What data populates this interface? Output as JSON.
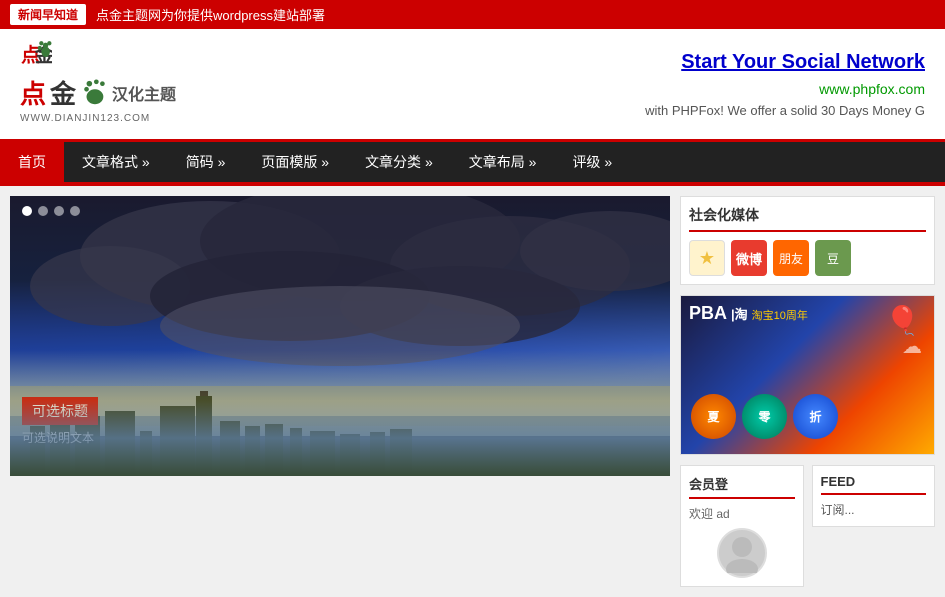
{
  "topbar": {
    "badge": "新闻早知道",
    "message": "点金主题网为你提供wordpress建站部署"
  },
  "header": {
    "logo_chinese": "点金",
    "logo_hanhua": "汉化主题",
    "logo_url": "WWW.DIANJIN123.COM",
    "social_network_title": "Start Your Social Network",
    "phpfox_url": "www.phpfox.com",
    "phpfox_desc": "with PHPFox! We offer a solid 30 Days Money G"
  },
  "nav": {
    "items": [
      {
        "label": "首页",
        "active": true
      },
      {
        "label": "文章格式 »",
        "active": false
      },
      {
        "label": "简码 »",
        "active": false
      },
      {
        "label": "页面模版 »",
        "active": false
      },
      {
        "label": "文章分类 »",
        "active": false
      },
      {
        "label": "文章布局 »",
        "active": false
      },
      {
        "label": "评级 »",
        "active": false
      }
    ]
  },
  "featured": {
    "dots": [
      true,
      false,
      false,
      false
    ],
    "caption_title": "可选标题",
    "caption_subtitle": "可选说明文本"
  },
  "social_widget": {
    "title": "社会化媒体",
    "icons": [
      {
        "name": "star",
        "symbol": "★"
      },
      {
        "name": "weibo",
        "symbol": "微"
      },
      {
        "name": "pengyou",
        "symbol": "朋"
      },
      {
        "name": "douban",
        "symbol": "豆"
      }
    ]
  },
  "member_widget": {
    "title": "会员登",
    "welcome": "欢迎 ad"
  },
  "feed_widget": {
    "title": "FEED",
    "subscribe": "订阅..."
  },
  "banner": {
    "pba": "PBA",
    "taobao": "i淘  淘宝10周年",
    "circle1": "夏",
    "circle2": "零",
    "circle3": ""
  }
}
